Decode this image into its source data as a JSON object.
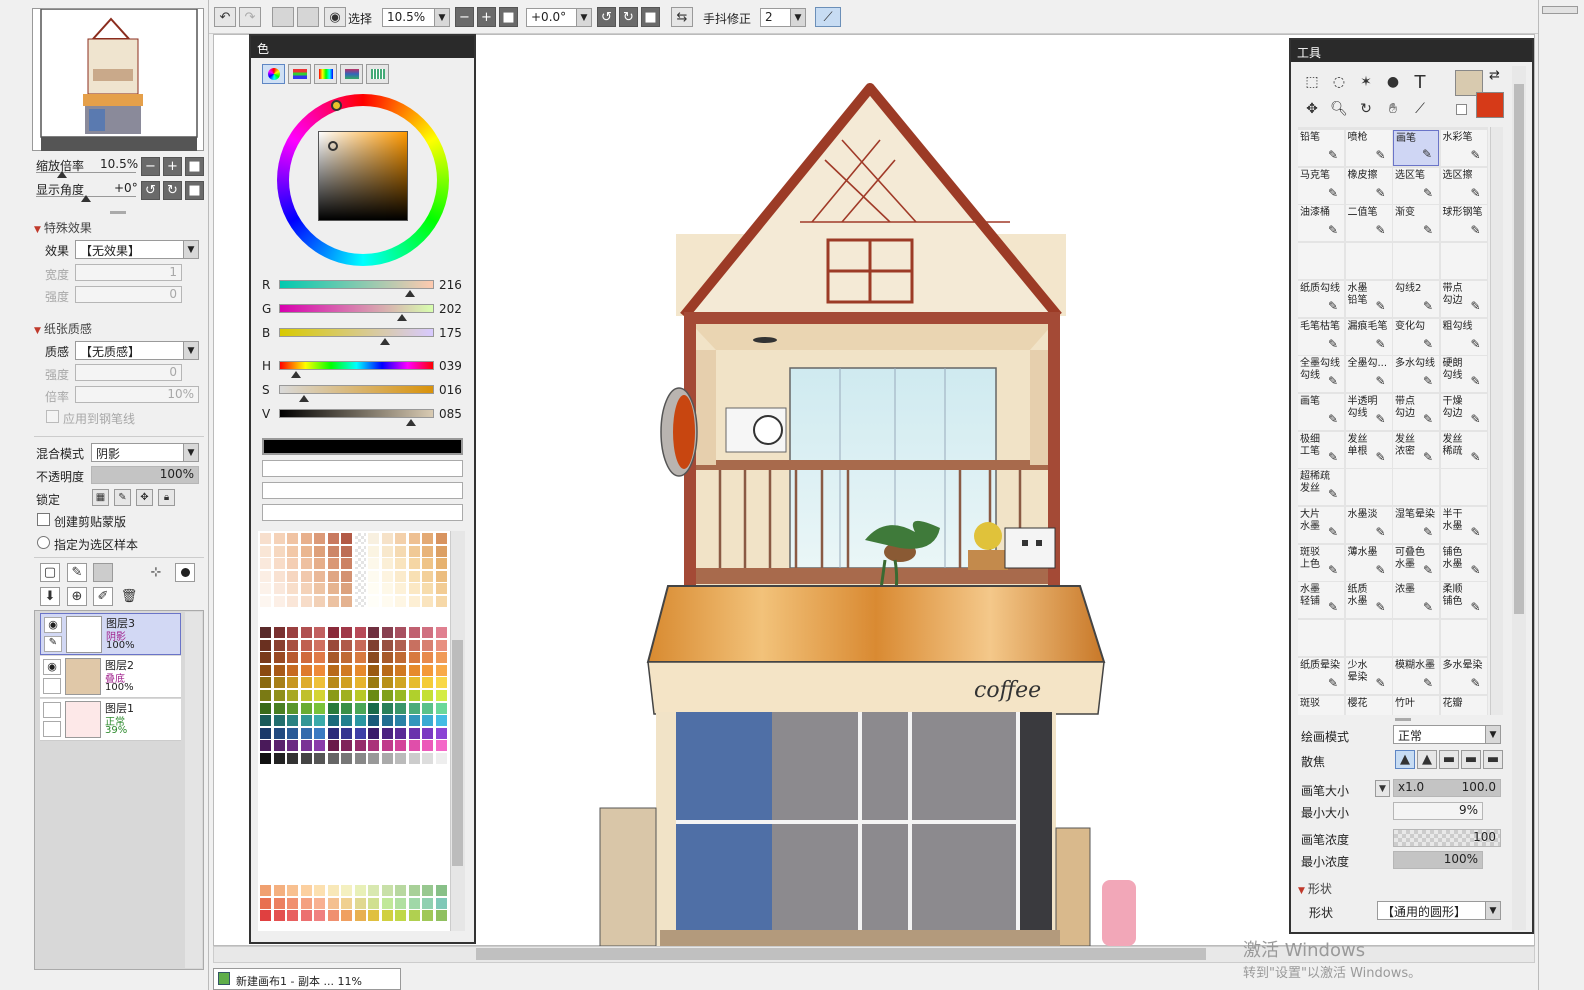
{
  "toolbar": {
    "select_label": "选择",
    "zoom": "10.5%",
    "rotation": "+0.0°",
    "stabilizer_label": "手抖修正",
    "stabilizer_value": "2"
  },
  "navigator": {
    "zoom_label": "缩放倍率",
    "zoom_value": "10.5%",
    "angle_label": "显示角度",
    "angle_value": "+0°"
  },
  "effects": {
    "title": "特殊效果",
    "effect_label": "效果",
    "effect_value": "【无效果】",
    "width_label": "宽度",
    "width_value": "1",
    "strength_label": "强度",
    "strength_value": "0"
  },
  "paper": {
    "title": "纸张质感",
    "texture_label": "质感",
    "texture_value": "【无质感】",
    "strength_label": "强度",
    "strength_value": "0",
    "ratio_label": "倍率",
    "ratio_value": "10%",
    "apply_label": "应用到钢笔线"
  },
  "layer_props": {
    "blend_label": "混合模式",
    "blend_value": "阴影",
    "opacity_label": "不透明度",
    "opacity_value": "100%",
    "lock_label": "锁定",
    "clip_label": "创建剪贴蒙版",
    "sample_label": "指定为选区样本"
  },
  "layers": [
    {
      "name": "图层3",
      "mode": "阴影",
      "opacity": "100%",
      "mode_color": "#a0208c"
    },
    {
      "name": "图层2",
      "mode": "叠底",
      "opacity": "100%",
      "mode_color": "#a0208c"
    },
    {
      "name": "图层1",
      "mode": "正常",
      "opacity": "39%",
      "mode_color": "#2c8a2c"
    }
  ],
  "color_panel": {
    "title": "色",
    "r_label": "R",
    "r": "216",
    "g_label": "G",
    "g": "202",
    "b_label": "B",
    "b": "175",
    "h_label": "H",
    "h": "039",
    "s_label": "S",
    "s": "016",
    "v_label": "V",
    "v": "085"
  },
  "tools_panel": {
    "title": "工具",
    "main_color": "#d8caaf",
    "sub_color": "#d63a18"
  },
  "tools": [
    "铅笔",
    "喷枪",
    "画笔",
    "水彩笔",
    "马克笔",
    "橡皮擦",
    "选区笔",
    "选区擦",
    "油漆桶",
    "二值笔",
    "渐变",
    "球形钢笔",
    "",
    "",
    "",
    "",
    "纸质勾线",
    "水墨\n铅笔",
    "勾线2",
    "带点\n勾边",
    "毛笔枯笔",
    "漏痕毛笔",
    "变化勾",
    "粗勾线",
    "全墨勾线\n勾线",
    "全墨勾...",
    "多水勾线",
    "硬朗\n勾线",
    "画笔",
    "半透明\n勾线",
    "带点\n勾边",
    "干燥\n勾边",
    "极细\n工笔",
    "发丝\n单根",
    "发丝\n浓密",
    "发丝\n稀疏",
    "超稀疏\n发丝",
    "",
    "",
    "",
    "大片\n水墨",
    "水墨淡",
    "湿笔晕染",
    "半干\n水墨",
    "斑驳\n上色",
    "薄水墨",
    "可叠色\n水墨",
    "铺色\n水墨",
    "水墨\n轻铺",
    "纸质\n水墨",
    "浓墨",
    "柔顺\n铺色",
    "",
    "",
    "",
    "",
    "纸质晕染",
    "少水\n晕染",
    "模糊水墨",
    "多水晕染",
    "斑驳",
    "樱花",
    "竹叶",
    "花瓣"
  ],
  "brush": {
    "mode_label": "绘画模式",
    "mode_value": "正常",
    "blur_label": "散焦",
    "size_label": "画笔大小",
    "size_mult": "x1.0",
    "size_value": "100.0",
    "min_size_label": "最小大小",
    "min_size_value": "9%",
    "density_label": "画笔浓度",
    "density_value": "100",
    "min_density_label": "最小浓度",
    "min_density_value": "100%",
    "shape_title": "形状",
    "shape_label": "形状",
    "shape_value": "【通用的圆形】"
  },
  "canvas": {
    "sign_text": "coffee"
  },
  "statusbar": {
    "doc_tab": "新建画布1 - 副本 ... 11%"
  },
  "watermark": {
    "line1": "激活 Windows",
    "line2": "转到\"设置\"以激活 Windows。"
  },
  "icons": [
    "undo-icon",
    "redo-icon",
    "eye-icon",
    "minus-icon",
    "plus-icon",
    "reset-icon",
    "rotate-left-icon",
    "rotate-right-icon",
    "flip-icon",
    "pen-tool-icon",
    "new-layer-icon",
    "trash-icon",
    "lock-icon"
  ]
}
